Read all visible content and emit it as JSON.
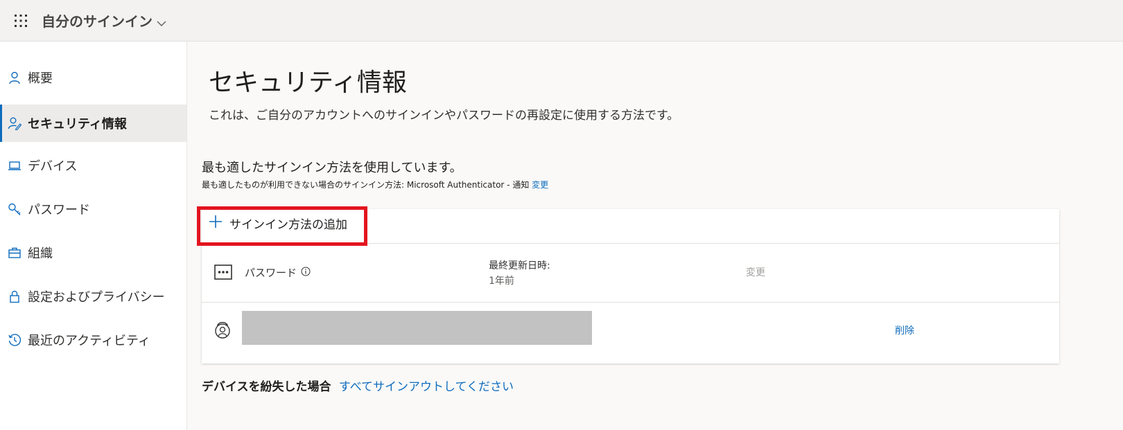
{
  "app": {
    "title": "自分のサインイン"
  },
  "sidebar": {
    "items": [
      {
        "label": "概要",
        "icon": "person-icon"
      },
      {
        "label": "セキュリティ情報",
        "icon": "person-edit-icon",
        "active": true
      },
      {
        "label": "デバイス",
        "icon": "laptop-icon"
      },
      {
        "label": "パスワード",
        "icon": "key-icon"
      },
      {
        "label": "組織",
        "icon": "briefcase-icon"
      },
      {
        "label": "設定およびプライバシー",
        "icon": "lock-icon"
      },
      {
        "label": "最近のアクティビティ",
        "icon": "history-icon"
      }
    ]
  },
  "main": {
    "title": "セキュリティ情報",
    "description": "これは、ご自分のアカウントへのサインインやパスワードの再設定に使用する方法です。",
    "default_heading": "最も適したサインイン方法を使用しています。",
    "default_sub": "最も適したものが利用できない場合のサインイン方法: Microsoft Authenticator - 通知",
    "default_change": "変更",
    "add_method": "サインイン方法の追加",
    "methods": [
      {
        "name": "パスワード",
        "icon": "password-dots-icon",
        "meta_label": "最終更新日時:",
        "meta_value": "1年前",
        "action": "変更"
      },
      {
        "icon": "authenticator-icon",
        "action": "削除"
      }
    ],
    "lost_device_label": "デバイスを紛失した場合",
    "lost_device_link": "すべてサインアウトしてください"
  },
  "colors": {
    "accent": "#0f6cbd",
    "highlight": "#e3141f",
    "redacted": "#c2c2c2"
  }
}
